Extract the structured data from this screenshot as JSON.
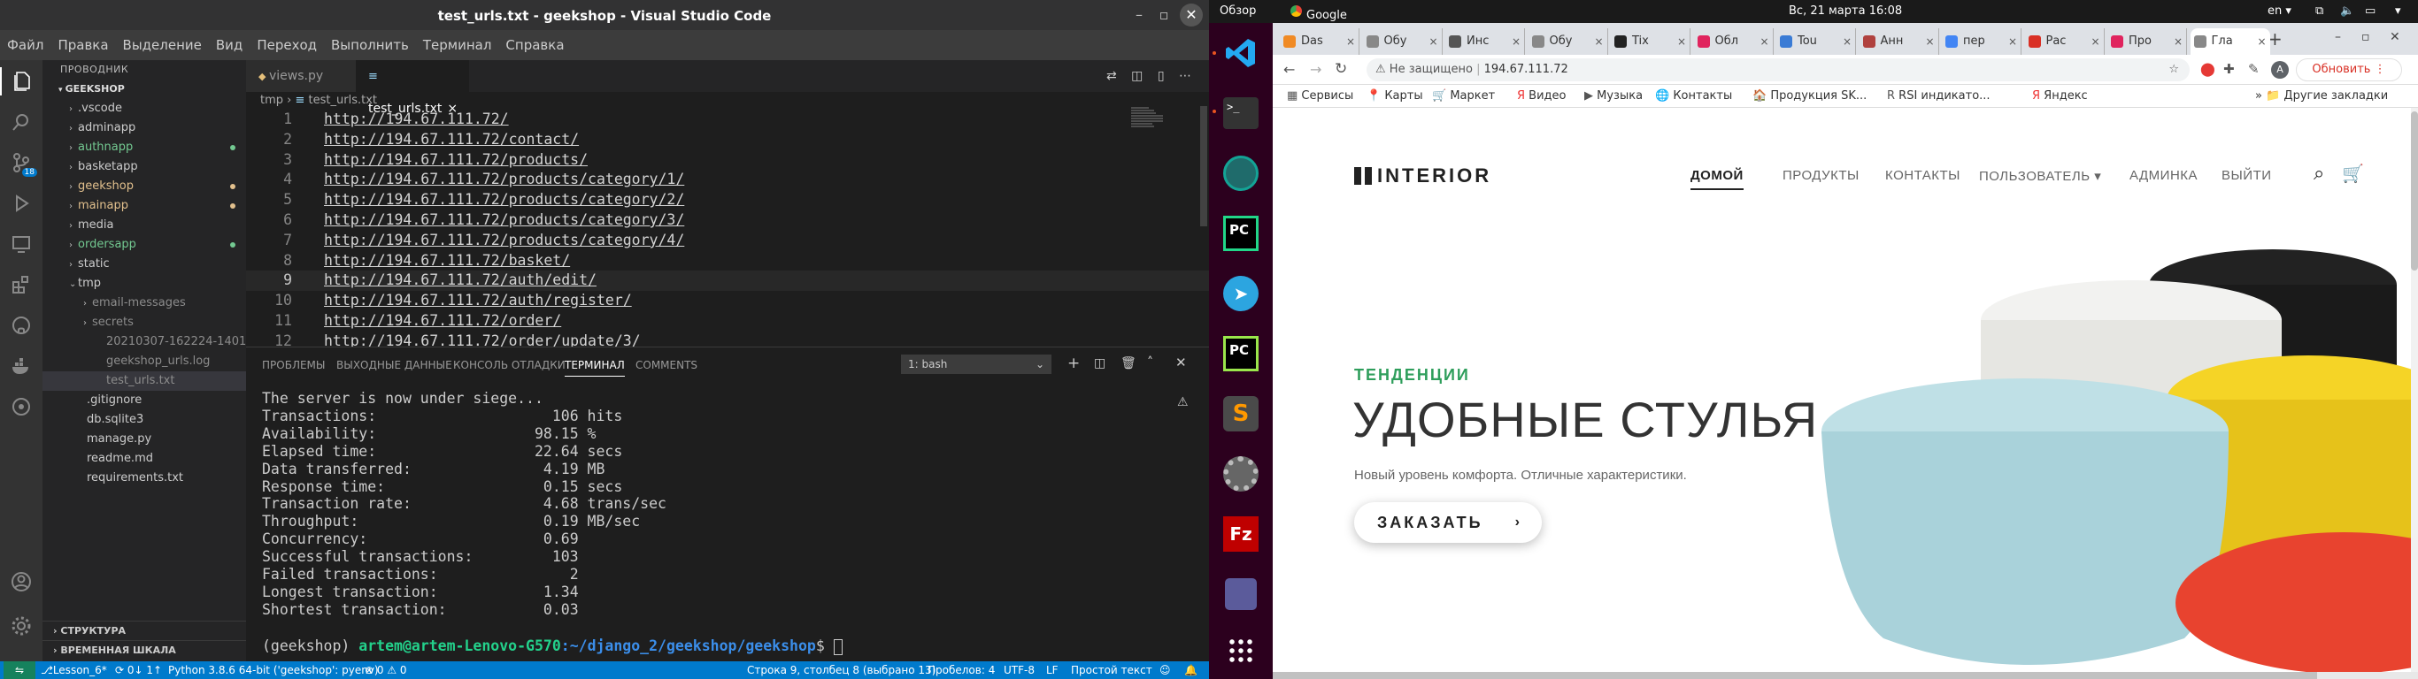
{
  "vscode": {
    "title": "test_urls.txt - geekshop - Visual Studio Code",
    "window_controls": {
      "minimize": "–",
      "maximize": "▫",
      "close": "✕"
    },
    "menu": [
      "Файл",
      "Правка",
      "Выделение",
      "Вид",
      "Переход",
      "Выполнить",
      "Терминал",
      "Справка"
    ],
    "explorer": {
      "title": "ПРОВОДНИК",
      "root": "GEEKSHOP",
      "items": [
        {
          "label": ".vscode",
          "kind": "folder",
          "color": "#cccccc"
        },
        {
          "label": "adminapp",
          "kind": "folder",
          "color": "#cccccc"
        },
        {
          "label": "authnapp",
          "kind": "folder",
          "color": "#73c991"
        },
        {
          "label": "basketapp",
          "kind": "folder",
          "color": "#cccccc"
        },
        {
          "label": "geekshop",
          "kind": "folder",
          "color": "#e2c08d"
        },
        {
          "label": "mainapp",
          "kind": "folder",
          "color": "#e2c08d"
        },
        {
          "label": "media",
          "kind": "folder",
          "color": "#cccccc"
        },
        {
          "label": "ordersapp",
          "kind": "folder",
          "color": "#73c991"
        },
        {
          "label": "static",
          "kind": "folder",
          "color": "#cccccc"
        },
        {
          "label": "tmp",
          "kind": "folder-open",
          "color": "#cccccc"
        },
        {
          "label": "email-messages",
          "kind": "subfolder",
          "color": "#8c8c8c"
        },
        {
          "label": "secrets",
          "kind": "subfolder",
          "color": "#8c8c8c"
        },
        {
          "label": "20210307-162224-14014...",
          "kind": "subfile",
          "color": "#8c8c8c"
        },
        {
          "label": "geekshop_urls.log",
          "kind": "subfile",
          "color": "#8c8c8c"
        },
        {
          "label": "test_urls.txt",
          "kind": "subfile-active",
          "color": "#8c8c8c"
        },
        {
          "label": ".gitignore",
          "kind": "file",
          "color": "#cccccc"
        },
        {
          "label": "db.sqlite3",
          "kind": "file",
          "color": "#cccccc"
        },
        {
          "label": "manage.py",
          "kind": "file",
          "color": "#cccccc"
        },
        {
          "label": "readme.md",
          "kind": "file",
          "color": "#cccccc"
        },
        {
          "label": "requirements.txt",
          "kind": "file",
          "color": "#cccccc"
        }
      ],
      "outline": "СТРУКТУРА",
      "timeline": "ВРЕМЕННАЯ ШКАЛА"
    },
    "tabs": [
      "views.py",
      "test_urls.txt"
    ],
    "breadcrumb": {
      "folder": "tmp",
      "file": "test_urls.txt"
    },
    "lines": [
      {
        "n": "1",
        "t": "http://194.67.111.72/"
      },
      {
        "n": "2",
        "t": "http://194.67.111.72/contact/"
      },
      {
        "n": "3",
        "t": "http://194.67.111.72/products/"
      },
      {
        "n": "4",
        "t": "http://194.67.111.72/products/category/1/"
      },
      {
        "n": "5",
        "t": "http://194.67.111.72/products/category/2/"
      },
      {
        "n": "6",
        "t": "http://194.67.111.72/products/category/3/"
      },
      {
        "n": "7",
        "t": "http://194.67.111.72/products/category/4/"
      },
      {
        "n": "8",
        "t": "http://194.67.111.72/basket/"
      },
      {
        "n": "9",
        "t": "http://194.67.111.72/auth/edit/"
      },
      {
        "n": "10",
        "t": "http://194.67.111.72/auth/register/"
      },
      {
        "n": "11",
        "t": "http://194.67.111.72/order/"
      },
      {
        "n": "12",
        "t": "http://194.67.111.72/order/update/3/"
      }
    ],
    "panel_tabs": [
      "ПРОБЛЕМЫ",
      "ВЫХОДНЫЕ ДАННЫЕ",
      "КОНСОЛЬ ОТЛАДКИ",
      "ТЕРМИНАЛ",
      "COMMENTS"
    ],
    "terminal_select": "1: bash",
    "terminal": [
      "The server is now under siege...",
      "Transactions:\t\t         106 hits",
      "Availability:\t\t       98.15 %",
      "Elapsed time:\t\t       22.64 secs",
      "Data transferred:\t        4.19 MB",
      "Response time:\t\t        0.15 secs",
      "Transaction rate:\t        4.68 trans/sec",
      "Throughput:\t\t        0.19 MB/sec",
      "Concurrency:\t\t        0.69",
      "Successful transactions:         103",
      "Failed transactions:\t           2",
      "Longest transaction:\t        1.34",
      "Shortest transaction:\t        0.03"
    ],
    "prompt": {
      "env": "(geekshop) ",
      "user": "artem@artem-Lenovo-G570",
      "path": ":~/django_2/geekshop/geekshop",
      "end": "$ "
    },
    "status": {
      "branch": "Lesson_6*",
      "sync": "⟳ 0↓ 1↑",
      "python": "Python 3.8.6 64-bit ('geekshop': pyenv)",
      "problems": "⊗ 0 ⚠ 0",
      "position": "Строка 9, столбец 8 (выбрано 13)",
      "spaces": "Пробелов: 4",
      "encoding": "UTF-8",
      "eol": "LF",
      "lang": "Простой текст"
    },
    "scm_badge": "18"
  },
  "ubuntu": {
    "overview": "Обзор",
    "app": "Google Chrome ▾",
    "clock": "Вс, 21 марта  16:08",
    "lang": "en ▾"
  },
  "chrome": {
    "tabs": [
      "Das",
      "Обу",
      "Инс",
      "Обу",
      "Tix",
      "Обл",
      "Tou",
      "Анн",
      "пер",
      "Рас",
      "Про",
      "Гла"
    ],
    "tab_colors": [
      "#f08a24",
      "#888888",
      "#555555",
      "#888888",
      "#222222",
      "#e0245e",
      "#3a7bd5",
      "#b0413e",
      "#4285f4",
      "#d93025",
      "#e0245e",
      "#888888"
    ],
    "address": "194.67.111.72",
    "security": "Не защищено",
    "update": "Обновить",
    "bookmarks": [
      "Сервисы",
      "Карты",
      "Маркет",
      "Видео",
      "Музыка",
      "Контакты",
      "Продукция SK...",
      "RSI индикато...",
      "Яндекс"
    ],
    "other_bookmarks": "Другие закладки"
  },
  "site": {
    "logo": "INTERIOR",
    "nav": [
      "ДОМОЙ",
      "ПРОДУКТЫ",
      "КОНТАКТЫ",
      "ПОЛЬЗОВАТЕЛЬ ▾",
      "АДМИНКА",
      "ВЫЙТИ"
    ],
    "trend": "ТЕНДЕНЦИИ",
    "headline": "УДОБНЫЕ СТУЛЬЯ",
    "subtitle": "Новый уровень комфорта. Отличные характеристики.",
    "order": "ЗАКАЗАТЬ"
  }
}
